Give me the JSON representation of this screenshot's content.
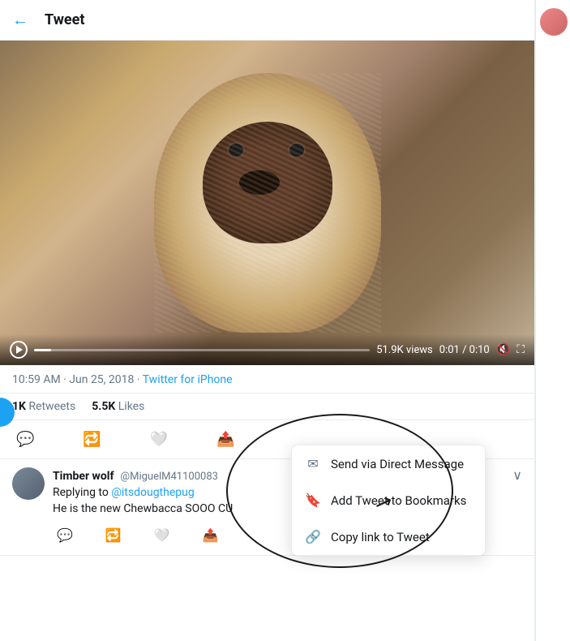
{
  "header": {
    "back_label": "←",
    "title": "Tweet"
  },
  "video": {
    "views": "51.9K views",
    "time_current": "0:01",
    "time_total": "0:10",
    "progress_pct": 5
  },
  "tweet_meta": {
    "timestamp": "10:59 AM · Jun 25, 2018 · ",
    "source": "Twitter for iPhone"
  },
  "stats": {
    "retweets_count": "1K",
    "retweets_label": "Retweets",
    "likes_count": "5.5K",
    "likes_label": "Likes"
  },
  "dropdown": {
    "item1_label": "Send via Direct Message",
    "item2_label": "Add Tweet to Bookmarks",
    "item3_label": "Copy link to Tweet"
  },
  "comment": {
    "author_name": "Timber wolf",
    "author_handle": "@MiguelM41100083",
    "reply_to": "@itsdougthepug",
    "text": "He is the new Chewbacca SOOO CU"
  }
}
